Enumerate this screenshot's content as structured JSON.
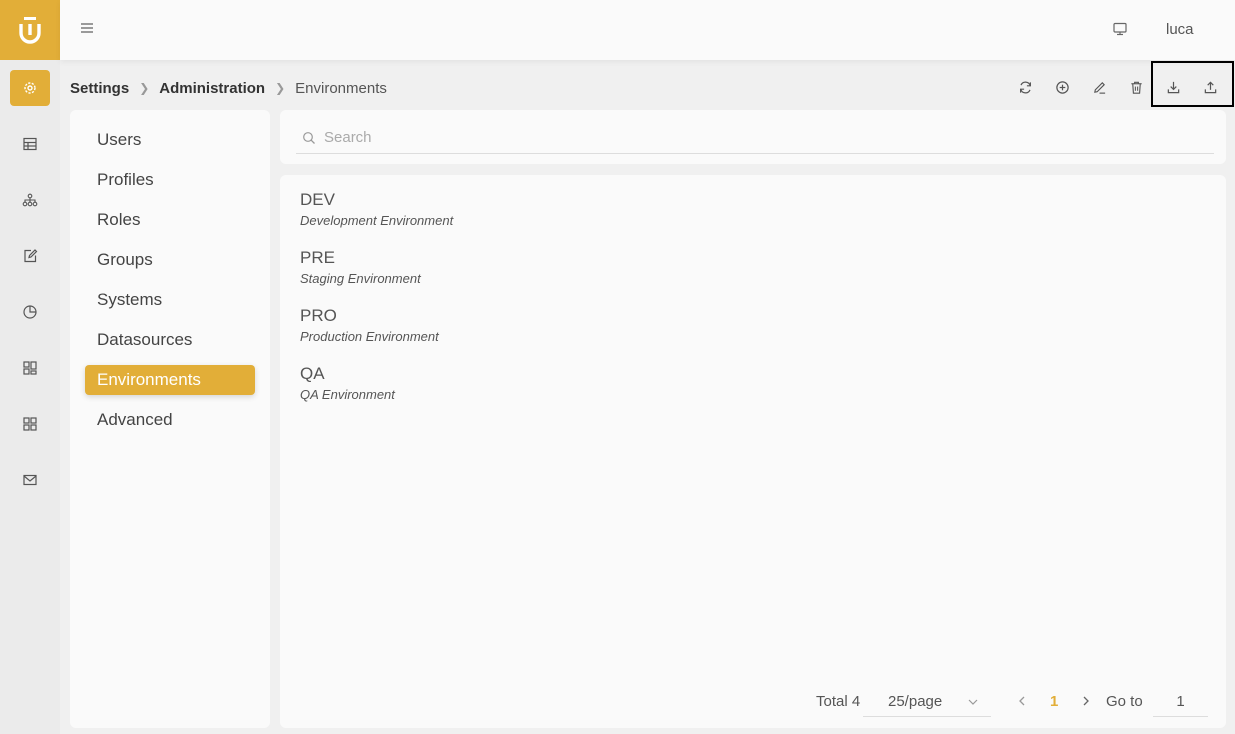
{
  "topbar": {
    "username": "luca"
  },
  "breadcrumb": [
    "Settings",
    "Administration",
    "Environments"
  ],
  "toolbar": [
    "refresh-icon",
    "add-circle-icon",
    "edit-icon",
    "delete-icon",
    "download-icon",
    "upload-icon"
  ],
  "rail": [
    "settings-icon",
    "table-icon",
    "hierarchy-icon",
    "edit-icon",
    "pie-chart-icon",
    "dashboard-icon",
    "grid-icon",
    "mail-icon"
  ],
  "settings_nav": {
    "items": [
      "Users",
      "Profiles",
      "Roles",
      "Groups",
      "Systems",
      "Datasources",
      "Environments",
      "Advanced"
    ],
    "active": "Environments"
  },
  "search": {
    "placeholder": "Search"
  },
  "environments": [
    {
      "name": "DEV",
      "description": "Development Environment"
    },
    {
      "name": "PRE",
      "description": "Staging Environment"
    },
    {
      "name": "PRO",
      "description": "Production Environment"
    },
    {
      "name": "QA",
      "description": "QA Environment"
    }
  ],
  "pagination": {
    "total": "Total 4",
    "page_size": "25/page",
    "current_page": "1",
    "goto_label": "Go to",
    "goto_value": "1"
  },
  "colors": {
    "accent": "#e2ae38"
  }
}
